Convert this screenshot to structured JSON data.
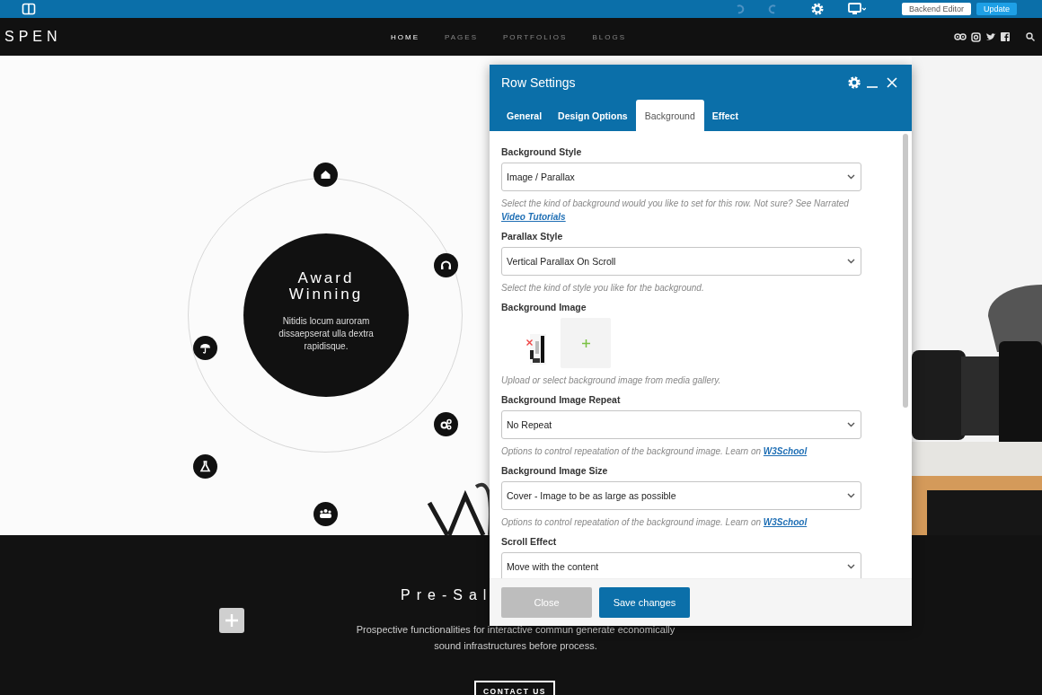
{
  "admin_bar": {
    "buttons": [
      {
        "label": "Backend Editor",
        "kind": "secondary"
      },
      {
        "label": "Update",
        "kind": "primary"
      }
    ]
  },
  "nav": {
    "logo": "SPEN",
    "items": [
      {
        "label": "HOME",
        "selected": true
      },
      {
        "label": "PAGES",
        "selected": false
      },
      {
        "label": "PORTFOLIOS",
        "selected": false
      },
      {
        "label": "BLOGS",
        "selected": false
      }
    ]
  },
  "hero": {
    "title": "Award Winning",
    "text": "Nitidis locum auroram dissaepserat ulla dextra rapidisque."
  },
  "dialog": {
    "title": "Row Settings",
    "tabs": [
      {
        "label": "General",
        "selected": false
      },
      {
        "label": "Design Options",
        "selected": false
      },
      {
        "label": "Background",
        "selected": true
      },
      {
        "label": "Effect",
        "selected": false
      }
    ],
    "fields": [
      {
        "kind": "select",
        "label": "Background Style",
        "value": "Image / Parallax",
        "help": "Select the kind of background would you like to set for this row. Not sure? See Narrated",
        "link": "Video Tutorials"
      },
      {
        "kind": "select",
        "label": "Parallax Style",
        "value": "Vertical Parallax On Scroll",
        "help": "Select the kind of style you like for the background."
      },
      {
        "label": "Background Image",
        "help": "Upload or select background image from media gallery."
      },
      {
        "kind": "select",
        "label": "Background Image Repeat",
        "value": "No Repeat",
        "help": "Options to control repeatation of the background image. Learn on",
        "link": "W3School"
      },
      {
        "kind": "select",
        "label": "Background Image Size",
        "value": "Cover - Image to be as large as possible",
        "help": "Options to control repeatation of the background image. Learn on",
        "link": "W3School"
      },
      {
        "kind": "select",
        "label": "Scroll Effect",
        "value": "Move with the content"
      }
    ],
    "buttons": [
      {
        "label": "Close",
        "kind": "secondary"
      },
      {
        "label": "Save changes",
        "kind": "primary"
      }
    ]
  },
  "section": {
    "title": "Pre-Sal",
    "text": "Prospective functionalities for interactive commun generate economically sound infrastructures before process.",
    "button": "CONTACT US"
  }
}
